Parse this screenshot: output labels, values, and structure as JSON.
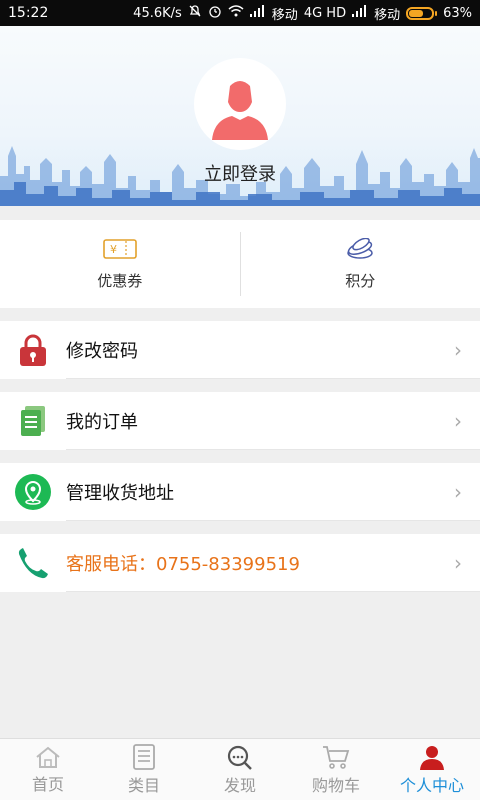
{
  "status_bar": {
    "time": "15:22",
    "net_speed": "45.6K/s",
    "carrier1": "移动",
    "network": "4G HD",
    "carrier2": "移动",
    "battery_pct": "63%",
    "battery_level": 0.63
  },
  "header": {
    "login_label": "立即登录"
  },
  "shortcuts": [
    {
      "label": "优惠券",
      "icon": "coupon-icon"
    },
    {
      "label": "积分",
      "icon": "points-icon"
    }
  ],
  "menu": [
    {
      "label": "修改密码",
      "icon": "lock-icon"
    },
    {
      "label": "我的订单",
      "icon": "order-icon"
    },
    {
      "label": "管理收货地址",
      "icon": "location-icon"
    },
    {
      "label": "客服电话：0755-83399519",
      "icon": "phone-icon"
    }
  ],
  "bottom_nav": [
    {
      "label": "首页",
      "icon": "home-icon"
    },
    {
      "label": "类目",
      "icon": "category-icon"
    },
    {
      "label": "发现",
      "icon": "discover-icon"
    },
    {
      "label": "购物车",
      "icon": "cart-icon"
    },
    {
      "label": "个人中心",
      "icon": "user-icon"
    }
  ],
  "colors": {
    "accent_blue": "#1e8fd8",
    "phone_orange": "#e8731a",
    "avatar_red": "#f26b6b",
    "lock_red": "#c9353a",
    "order_green": "#4caf50",
    "location_green": "#1db954"
  }
}
